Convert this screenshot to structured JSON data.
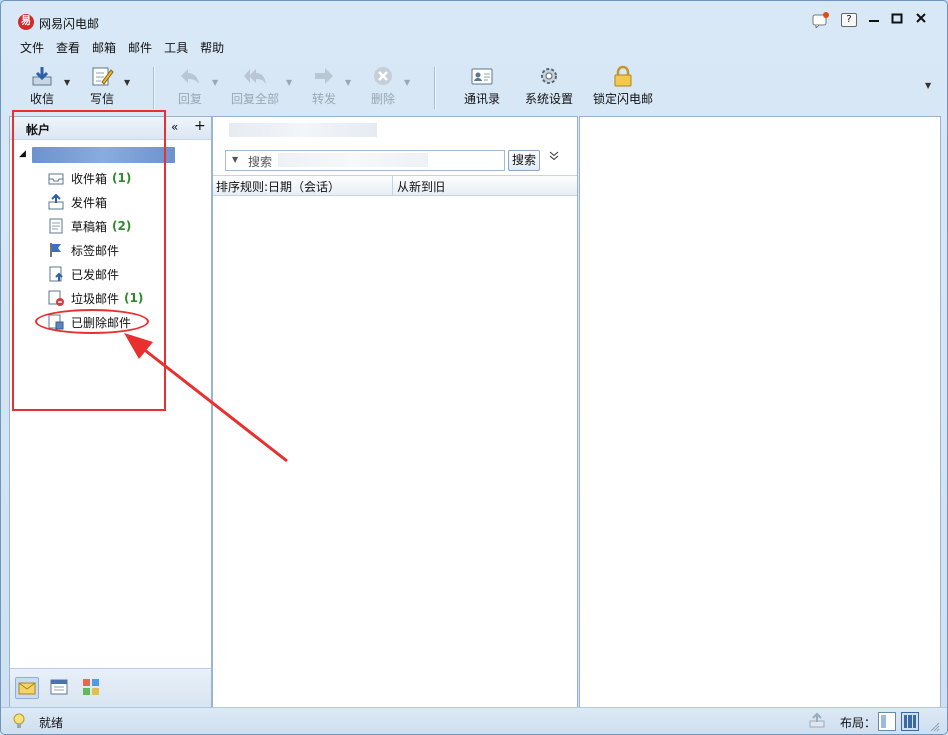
{
  "window": {
    "title": "网易闪电邮",
    "logo_glyph": "易"
  },
  "menu": [
    "文件",
    "查看",
    "邮箱",
    "邮件",
    "工具",
    "帮助"
  ],
  "toolbar": {
    "receive": "收信",
    "compose": "写信",
    "reply": "回复",
    "reply_all": "回复全部",
    "forward": "转发",
    "delete": "删除",
    "contacts": "通讯录",
    "settings": "系统设置",
    "lock": "锁定闪电邮"
  },
  "sidebar": {
    "title": "帐户",
    "collapse_glyph": "«",
    "add_glyph": "+",
    "folders": [
      {
        "label": "收件箱",
        "count": "(1)",
        "icon": "inbox-icon"
      },
      {
        "label": "发件箱",
        "count": "",
        "icon": "outbox-icon"
      },
      {
        "label": "草稿箱",
        "count": "(2)",
        "icon": "drafts-icon"
      },
      {
        "label": "标签邮件",
        "count": "",
        "icon": "flag-icon"
      },
      {
        "label": "已发邮件",
        "count": "",
        "icon": "sent-icon"
      },
      {
        "label": "垃圾邮件",
        "count": "(1)",
        "icon": "junk-icon"
      },
      {
        "label": "已删除邮件",
        "count": "",
        "icon": "trash-icon"
      }
    ]
  },
  "maillist": {
    "search_placeholder": "搜索",
    "search_button": "搜索",
    "sort_rule": "排序规则:日期（会话）",
    "sort_order": "从新到旧"
  },
  "statusbar": {
    "status": "就绪",
    "layout_label": "布局："
  },
  "colors": {
    "annotation": "#e8302e",
    "count_green": "#2e8b2e",
    "window_bg": "#d9e8f6"
  }
}
